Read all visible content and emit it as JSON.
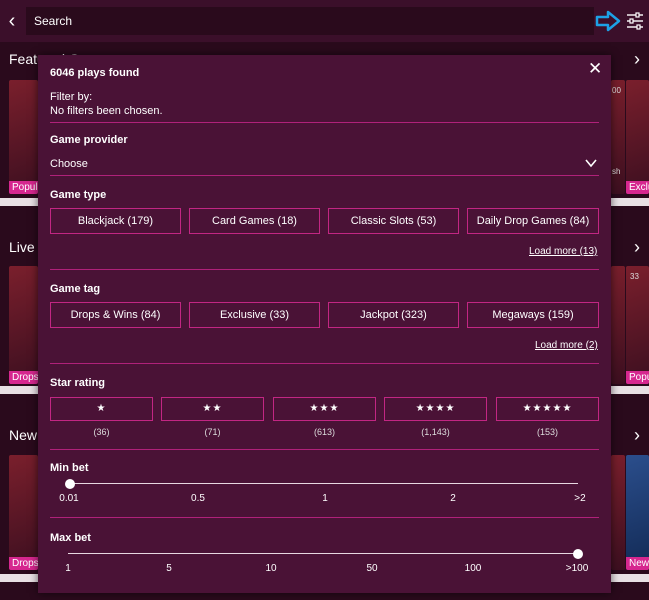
{
  "search": {
    "placeholder": "Search"
  },
  "background": {
    "rows": [
      {
        "title": "Featured G"
      },
      {
        "title": "Live C"
      },
      {
        "title": "New"
      }
    ],
    "badges": {
      "row1_left": "Popula",
      "row1_right": "Exclu",
      "row2_left": "Drops",
      "row2_right": "Popu",
      "row3_left": "Drops",
      "row3_right": "New"
    },
    "tile_numbers": {
      "row1": "00",
      "row1_name": "sh",
      "row2": "33"
    }
  },
  "modal": {
    "count": "6046 plays found",
    "filter_by": "Filter by:",
    "no_filters": "No filters been chosen.",
    "provider": {
      "label": "Game provider",
      "value": "Choose"
    },
    "game_type": {
      "label": "Game type",
      "chips": [
        "Blackjack (179)",
        "Card Games (18)",
        "Classic Slots (53)",
        "Daily Drop Games (84)"
      ],
      "load_more": "Load more (13)"
    },
    "game_tag": {
      "label": "Game tag",
      "chips": [
        "Drops & Wins (84)",
        "Exclusive (33)",
        "Jackpot (323)",
        "Megaways (159)"
      ],
      "load_more": "Load more (2)"
    },
    "star_rating": {
      "label": "Star rating",
      "options": [
        {
          "stars": "★",
          "count": "(36)"
        },
        {
          "stars": "★★",
          "count": "(71)"
        },
        {
          "stars": "★★★",
          "count": "(613)"
        },
        {
          "stars": "★★★★",
          "count": "(1,143)"
        },
        {
          "stars": "★★★★★",
          "count": "(153)"
        }
      ]
    },
    "min_bet": {
      "label": "Min bet",
      "ticks": [
        "0.01",
        "0.5",
        "1",
        "2",
        ">2"
      ],
      "selected": "0.01"
    },
    "max_bet": {
      "label": "Max bet",
      "ticks": [
        "1",
        "5",
        "10",
        "50",
        "100",
        ">100"
      ],
      "selected": ">100"
    }
  },
  "colors": {
    "background": "#2a0a1c",
    "modal": "#4a1236",
    "accent": "#c22683",
    "badge": "#d6278f",
    "hint_arrow": "#1da1e6"
  },
  "icons": {
    "back": "chevron-left-icon",
    "filter": "sliders-icon",
    "hint": "arrow-right-icon",
    "close": "close-icon",
    "dropdown": "chevron-down-icon"
  }
}
